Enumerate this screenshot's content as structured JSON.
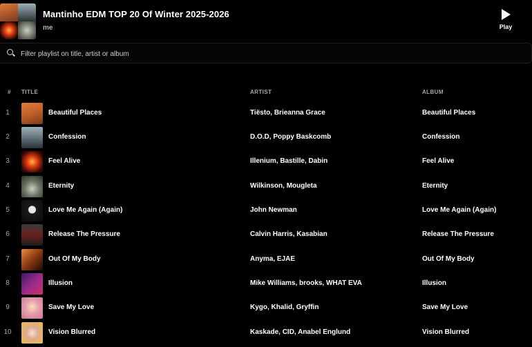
{
  "playlist": {
    "title": "Mantinho EDM TOP 20 Of Winter 2025-2026",
    "owner": "me",
    "cover_colors": [
      "#c4632a",
      "#5d6e78",
      "#8a1a0a",
      "#3b4330"
    ]
  },
  "play_button": {
    "label": "Play",
    "icon": "play-icon"
  },
  "filter": {
    "placeholder": "Filter playlist on title, artist or album",
    "value": "",
    "icon": "search-icon"
  },
  "columns": {
    "number": "#",
    "title": "TITLE",
    "artist": "ARTIST",
    "album": "ALBUM"
  },
  "tracks": [
    {
      "number": "1",
      "title": "Beautiful Places",
      "artist": "Tiësto, Brieanna Grace",
      "album": "Beautiful Places",
      "art": "linear-gradient(160deg,#e07b3a 0%,#c4632a 45%,#7a3a1c 100%)"
    },
    {
      "number": "2",
      "title": "Confession",
      "artist": "D.O.D, Poppy Baskcomb",
      "album": "Confession",
      "art": "linear-gradient(180deg,#9fb0b8 0%,#5d6e78 55%,#2a3236 100%)"
    },
    {
      "number": "3",
      "title": "Feel Alive",
      "artist": "Illenium, Bastille, Dabin",
      "album": "Feel Alive",
      "art": "radial-gradient(ellipse at center,#ffb347 0%,#e03a12 35%,#3a0a04 75%,#110202 100%)"
    },
    {
      "number": "4",
      "title": "Eternity",
      "artist": "Wilkinson, Mougleta",
      "album": "Eternity",
      "art": "radial-gradient(circle at 50% 60%,#c9d0c0 0%,#6d7563 45%,#2b3024 100%)"
    },
    {
      "number": "5",
      "title": "Love Me Again (Again)",
      "artist": "John Newman",
      "album": "Love Me Again (Again)",
      "art": "radial-gradient(circle at 50% 45%,#e8e8e8 0%,#e8e8e8 22%,#1a1a1a 26%,#0a0a0a 100%)"
    },
    {
      "number": "6",
      "title": "Release The Pressure",
      "artist": "Calvin Harris, Kasabian",
      "album": "Release The Pressure",
      "art": "linear-gradient(180deg,#3a3a3a 0%,#6b2020 50%,#1c1c1c 100%)"
    },
    {
      "number": "7",
      "title": "Out Of My Body",
      "artist": "Anyma, EJAE",
      "album": "Out Of My Body",
      "art": "linear-gradient(135deg,#f08a3a 0%,#8a3a12 50%,#1a0a04 100%)"
    },
    {
      "number": "8",
      "title": "Illusion",
      "artist": "Mike Williams, brooks, WHAT EVA",
      "album": "Illusion",
      "art": "linear-gradient(135deg,#3a1a6a 0%,#9a2a8a 50%,#d0306a 100%)"
    },
    {
      "number": "9",
      "title": "Save My Love",
      "artist": "Kygo, Khalid, Gryffin",
      "album": "Save My Love",
      "art": "radial-gradient(circle at 50% 45%,#f6e6b0 0%,#e8a0b0 40%,#c97a90 100%)"
    },
    {
      "number": "10",
      "title": "Vision Blurred",
      "artist": "Kaskade, CID, Anabel Englund",
      "album": "Vision Blurred",
      "art": "radial-gradient(circle at 50% 50%,#f2e0d0 0%,#e0a890 40%,#e8c040 100%)"
    }
  ]
}
